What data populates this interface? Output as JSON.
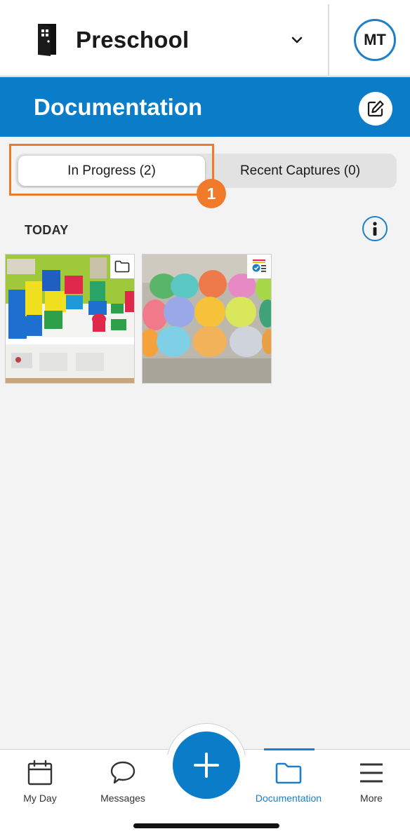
{
  "header": {
    "site_name": "Preschool",
    "avatar_initials": "MT"
  },
  "titlebar": {
    "title": "Documentation"
  },
  "tabs": [
    {
      "label": "In Progress (2)",
      "selected": true
    },
    {
      "label": "Recent Captures (0)",
      "selected": false
    }
  ],
  "annotation": {
    "step_number": "1",
    "color": "#f07a2a"
  },
  "section": {
    "title": "TODAY"
  },
  "items": [
    {
      "corner_icon": "folder-icon",
      "photo": "toy-blocks-shelf"
    },
    {
      "corner_icon": "checklist-icon",
      "photo": "colored-eggs-carton"
    }
  ],
  "bottom_nav": [
    {
      "label": "My Day",
      "icon": "calendar-icon",
      "active": false
    },
    {
      "label": "Messages",
      "icon": "chat-bubble-icon",
      "active": false
    },
    {
      "label": "Documentation",
      "icon": "folder-icon",
      "active": true
    },
    {
      "label": "More",
      "icon": "hamburger-menu-icon",
      "active": false
    }
  ],
  "colors": {
    "brand_blue": "#0b7cc8",
    "accent_orange": "#f07a2a",
    "background": "#f3f3f3"
  }
}
